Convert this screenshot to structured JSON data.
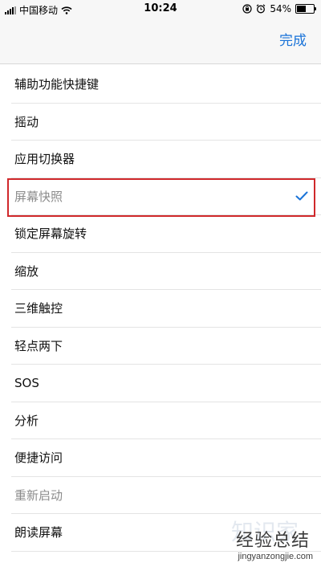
{
  "status_bar": {
    "carrier": "中国移动",
    "time": "10:24",
    "battery": "54%",
    "battery_level": 0.54,
    "signal_icon": "signal-bars-icon",
    "wifi_icon": "wifi-icon",
    "lock_icon": "orientation-lock-icon",
    "alarm_icon": "alarm-icon"
  },
  "nav": {
    "done_label": "完成",
    "accent_color": "#1a73d8"
  },
  "items": [
    {
      "label": "辅助功能快捷键"
    },
    {
      "label": "摇动"
    },
    {
      "label": "应用切换器"
    },
    {
      "label": "屏幕快照",
      "selected": true
    },
    {
      "label": "锁定屏幕旋转"
    },
    {
      "label": "缩放"
    },
    {
      "label": "三维触控"
    },
    {
      "label": "轻点两下"
    },
    {
      "label": "SOS"
    },
    {
      "label": "分析"
    },
    {
      "label": "便捷访问"
    },
    {
      "label": "重新启动",
      "disabled": true
    },
    {
      "label": "朗读屏幕"
    }
  ],
  "highlight_color": "#d0282b",
  "watermark": {
    "main": "经验总结",
    "sub": "jingyanzongjie.com",
    "ghost": "知识家"
  }
}
